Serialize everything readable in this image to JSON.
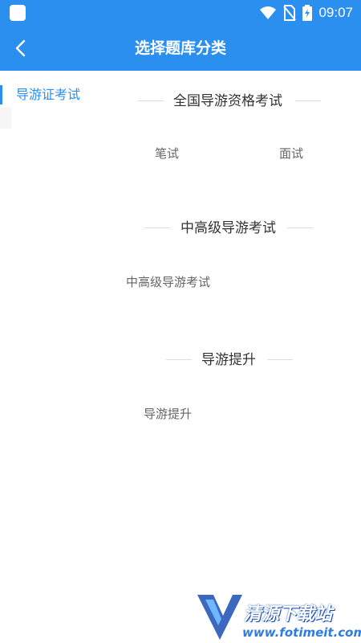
{
  "status_bar": {
    "time": "09:07"
  },
  "app_bar": {
    "title": "选择题库分类"
  },
  "sidebar": {
    "items": [
      {
        "label": "导游证考试",
        "selected": true
      }
    ]
  },
  "sections": [
    {
      "title": "全国导游资格考试",
      "options": [
        "笔试",
        "面试"
      ]
    },
    {
      "title": "中高级导游考试",
      "options": [
        "中高级导游考试"
      ]
    },
    {
      "title": "导游提升",
      "options": [
        "导游提升"
      ]
    }
  ],
  "watermark": {
    "text": "清源下载站",
    "url": "www.fotimeit.com"
  },
  "colors": {
    "primary": "#2b8ff0",
    "text": "#333333",
    "muted": "#666666"
  }
}
